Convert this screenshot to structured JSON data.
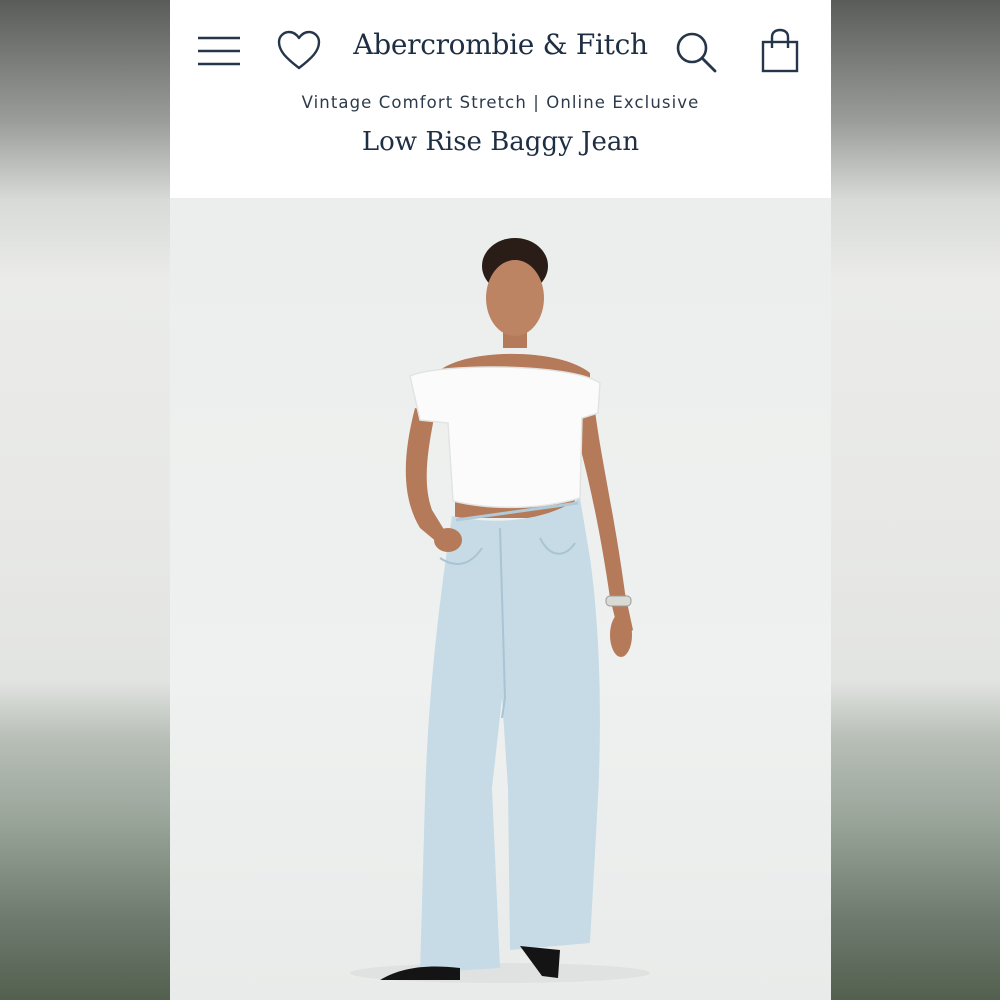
{
  "header": {
    "brand": "Abercrombie & Fitch",
    "subtitle": "Vintage Comfort Stretch | Online Exclusive",
    "product_title": "Low Rise Baggy Jean"
  },
  "icons": {
    "menu": "hamburger-menu-icon",
    "wishlist": "heart-icon",
    "search": "search-icon",
    "bag": "shopping-bag-icon"
  },
  "colors": {
    "brand_navy": "#1f2f43",
    "background": "#ffffff",
    "denim": "#c6dbe6"
  }
}
